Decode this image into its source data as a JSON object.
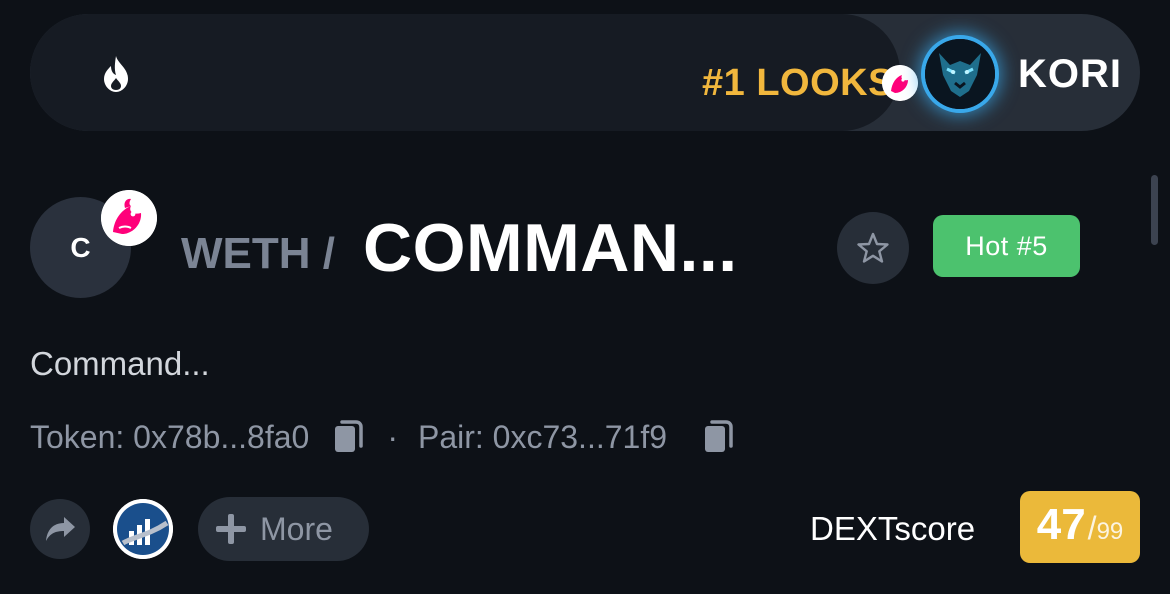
{
  "ticker": {
    "icon": "fire-icon",
    "rank_label": "#1 LOOKS",
    "highlight_name": "KORI",
    "rank_color": "#f1b73d",
    "avatar_glow_color": "#39a8ea"
  },
  "pair": {
    "token_initial": "C",
    "dex_icon": "uniswap-icon",
    "quote": "WETH /",
    "base": "COMMAN...",
    "hot_badge": "Hot #5",
    "hot_color": "#4cc26e",
    "star_icon": "star-icon"
  },
  "description": "Command...",
  "addresses": {
    "token_label": "Token: 0x78b...8fa0",
    "separator": "·",
    "pair_label": "Pair: 0xc73...71f9",
    "copy_icon": "copy-icon"
  },
  "actions": {
    "share_icon": "share-icon",
    "chart_icon": "coinmarketcap-icon",
    "more_label": "More",
    "plus_icon": "plus-icon"
  },
  "dextscore": {
    "label": "DEXTscore",
    "score": "47",
    "slash": "/",
    "max": "99",
    "color": "#ebb93a"
  }
}
